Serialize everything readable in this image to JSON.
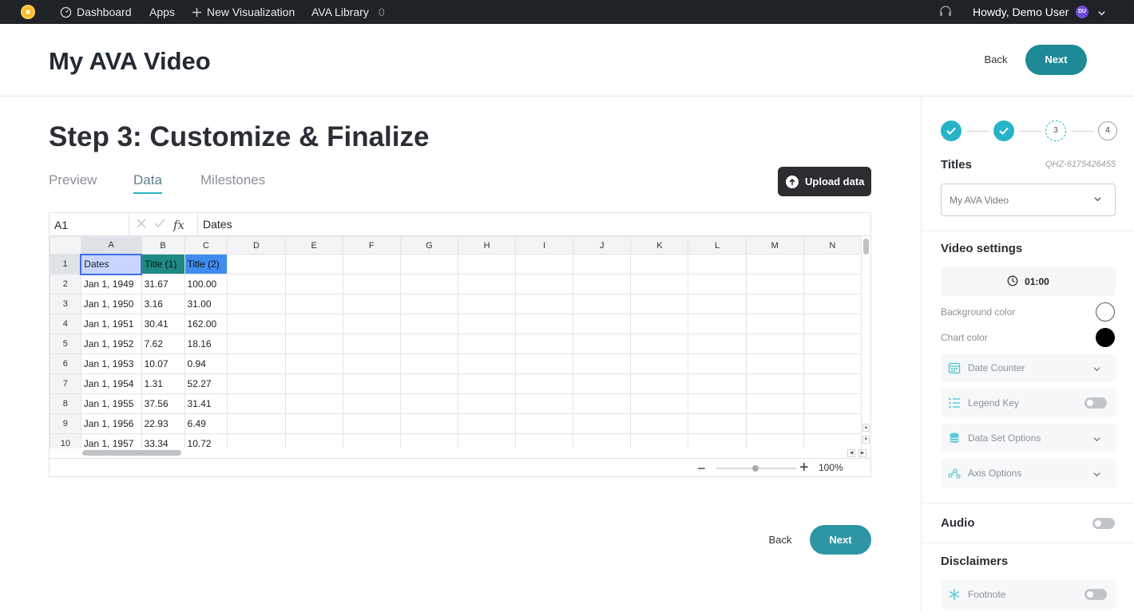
{
  "nav": {
    "dashboard": "Dashboard",
    "apps": "Apps",
    "new_visualization": "New Visualization",
    "ava_library": "AVA Library",
    "ava_library_count": "0",
    "howdy": "Howdy, Demo User",
    "avatar_initials": "DU"
  },
  "header": {
    "title": "My AVA Video",
    "back_label": "Back",
    "next_label": "Next"
  },
  "main": {
    "step_title": "Step 3: Customize & Finalize",
    "tabs": [
      {
        "label": "Preview",
        "active": false
      },
      {
        "label": "Data",
        "active": true
      },
      {
        "label": "Milestones",
        "active": false
      }
    ],
    "upload_label": "Upload data",
    "back_label": "Back",
    "next_label": "Next"
  },
  "sheet": {
    "cell_ref": "A1",
    "formula_value": "Dates",
    "fx_label": "fx",
    "columns": [
      "A",
      "B",
      "C",
      "D",
      "E",
      "F",
      "G",
      "H",
      "I",
      "J",
      "K",
      "L",
      "M",
      "N"
    ],
    "rows": [
      [
        "Dates",
        "Title (1)",
        "Title (2)"
      ],
      [
        "Jan 1, 1949",
        "31.67",
        "100.00"
      ],
      [
        "Jan 1, 1950",
        "3.16",
        "31.00"
      ],
      [
        "Jan 1, 1951",
        "30.41",
        "162.00"
      ],
      [
        "Jan 1, 1952",
        "7.62",
        "18.16"
      ],
      [
        "Jan 1, 1953",
        "10.07",
        "0.94"
      ],
      [
        "Jan 1, 1954",
        "1.31",
        "52.27"
      ],
      [
        "Jan 1, 1955",
        "37.56",
        "31.41"
      ],
      [
        "Jan 1, 1956",
        "22.93",
        "6.49"
      ],
      [
        "Jan 1, 1957",
        "33.34",
        "10.72"
      ]
    ],
    "header_colors": {
      "dates": "#c9d5ff",
      "title1": "#1d8a84",
      "title2": "#3f8cf1"
    },
    "zoom_level": "100%"
  },
  "panel": {
    "steps": [
      {
        "label": "",
        "state": "done"
      },
      {
        "label": "",
        "state": "done"
      },
      {
        "label": "3",
        "state": "current"
      },
      {
        "label": "4",
        "state": "todo"
      }
    ],
    "titles_heading": "Titles",
    "code": "QHZ-6175426455",
    "title_select_value": "My AVA Video",
    "video_settings_heading": "Video settings",
    "duration": "01:00",
    "background_color_label": "Background color",
    "background_color": "#ffffff",
    "chart_color_label": "Chart color",
    "chart_color": "#000000",
    "date_counter_label": "Date Counter",
    "legend_key_label": "Legend Key",
    "data_set_options_label": "Data Set Options",
    "axis_options_label": "Axis Options",
    "audio_heading": "Audio",
    "disclaimers_heading": "Disclaimers",
    "footnote_label": "Footnote",
    "accent_color": "#27b4c7"
  }
}
